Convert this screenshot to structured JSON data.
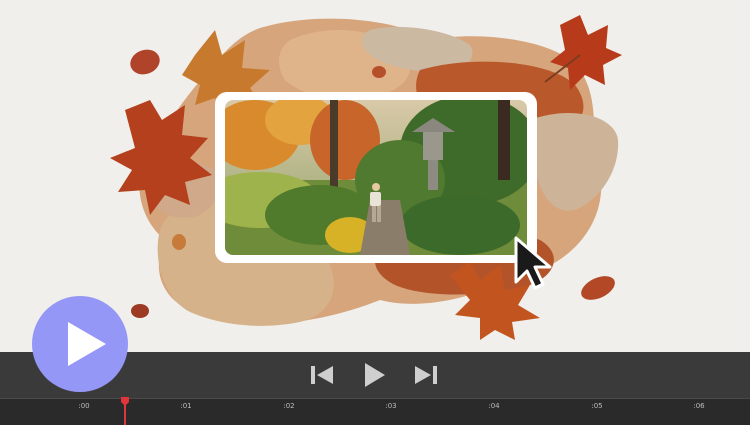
{
  "player": {
    "big_play_icon": "play-icon",
    "controls": {
      "previous_icon": "skip-previous-icon",
      "play_icon": "play-icon",
      "next_icon": "skip-next-icon"
    },
    "timeline": {
      "ticks": [
        ":00",
        ":01",
        ":02",
        ":03",
        ":04",
        ":05",
        ":06"
      ],
      "playhead_seconds": 0.4
    }
  },
  "colors": {
    "accent_play": "#9597f7",
    "control_bar": "#3a3a3a",
    "timeline_bg": "#2a2a2a",
    "playhead": "#e0353a"
  }
}
